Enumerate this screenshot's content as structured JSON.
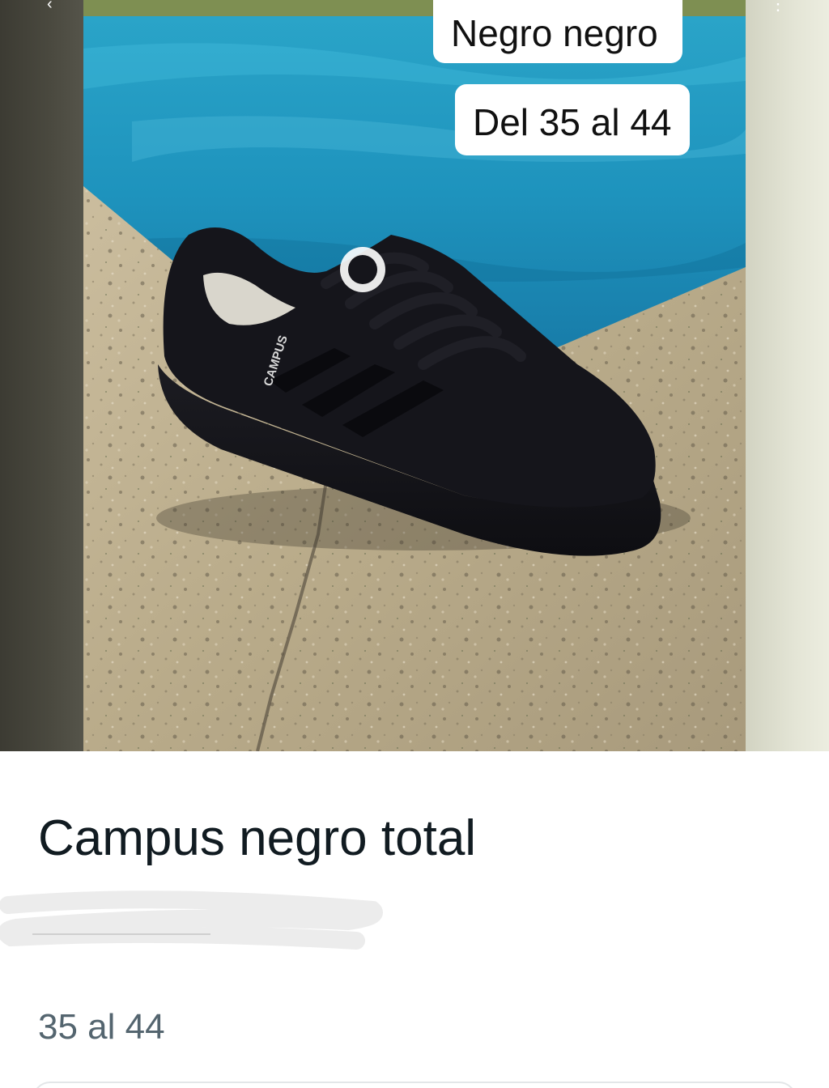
{
  "image": {
    "subject": "shoe-photo",
    "overlay_color_label": "Negro negro",
    "overlay_size_label": "Del 35 al 44",
    "shoe_brand_text": "CAMPUS"
  },
  "product": {
    "title": "Campus negro total",
    "description": "35 al 44"
  },
  "icons": {
    "back": "chevron-up-icon",
    "more": "more-dots-icon"
  },
  "colors": {
    "title_text": "#111b21",
    "secondary_text": "#54656f",
    "badge_bg": "#ffffff"
  }
}
